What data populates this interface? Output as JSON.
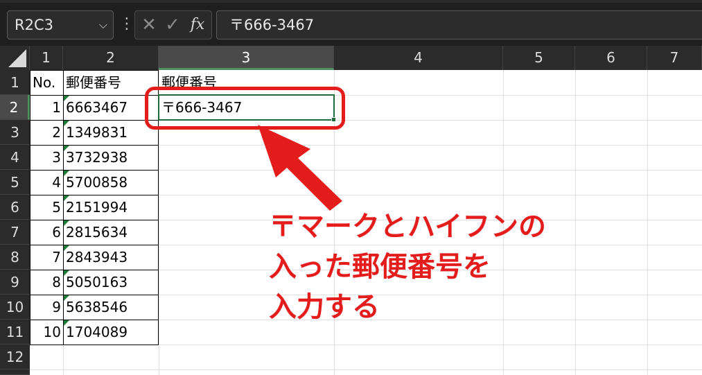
{
  "formula_bar": {
    "name_box": "R2C3",
    "name_box_arrow": "⌵",
    "dots": "⋮",
    "cancel": "✕",
    "enter": "✓",
    "fx": "fx",
    "formula": "〒666-3467"
  },
  "columns": [
    "1",
    "2",
    "3",
    "4",
    "5",
    "6",
    "7"
  ],
  "rows": [
    "1",
    "2",
    "3",
    "4",
    "5",
    "6",
    "7",
    "8",
    "9",
    "10",
    "11",
    "12"
  ],
  "selected": {
    "column": "3",
    "row": "2"
  },
  "sheet": {
    "header_no": "No.",
    "header_zip": "郵便番号",
    "header_zip2": "郵便番号",
    "entries": [
      {
        "no": "1",
        "zip": "6663467"
      },
      {
        "no": "2",
        "zip": "1349831"
      },
      {
        "no": "3",
        "zip": "3732938"
      },
      {
        "no": "4",
        "zip": "5700858"
      },
      {
        "no": "5",
        "zip": "2151994"
      },
      {
        "no": "6",
        "zip": "2815634"
      },
      {
        "no": "7",
        "zip": "2843943"
      },
      {
        "no": "8",
        "zip": "5050163"
      },
      {
        "no": "9",
        "zip": "5638546"
      },
      {
        "no": "10",
        "zip": "1704089"
      }
    ],
    "active_value": "〒666-3467"
  },
  "annotation": {
    "lines": [
      "〒マークとハイフンの",
      "入った郵便番号を",
      "入力する"
    ],
    "color": "#e51c1c"
  }
}
